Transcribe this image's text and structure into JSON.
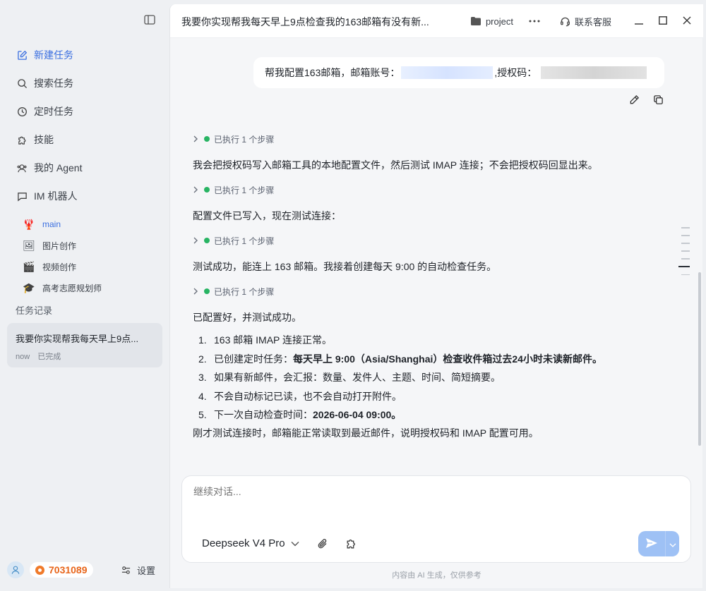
{
  "sidebar": {
    "nav": [
      {
        "label": "新建任务",
        "icon": "edit-icon"
      },
      {
        "label": "搜索任务",
        "icon": "search-icon"
      },
      {
        "label": "定时任务",
        "icon": "clock-icon"
      },
      {
        "label": "技能",
        "icon": "puzzle-icon"
      },
      {
        "label": "我的 Agent",
        "icon": "agent-icon"
      },
      {
        "label": "IM 机器人",
        "icon": "chat-icon"
      }
    ],
    "agents": [
      {
        "label": "main",
        "emoji": "🦞"
      },
      {
        "label": "图片创作",
        "emoji": "🖼"
      },
      {
        "label": "视频创作",
        "emoji": "🎬"
      },
      {
        "label": "高考志愿规划师",
        "emoji": "🎓"
      }
    ],
    "history_title": "任务记录",
    "task": {
      "title": "我要你实现帮我每天早上9点...",
      "time": "now",
      "status": "已完成"
    },
    "points": "7031089",
    "settings_label": "设置"
  },
  "header": {
    "title": "我要你实现帮我每天早上9点检查我的163邮箱有没有新...",
    "project_label": "project",
    "support_label": "联系客服"
  },
  "conversation": {
    "user_message": {
      "prefix": "帮我配置163邮箱，邮箱账号：",
      "middle": ",授权码："
    },
    "step_label": "已执行 1 个步骤",
    "paragraphs": [
      "我会把授权码写入邮箱工具的本地配置文件，然后测试 IMAP 连接；不会把授权码回显出来。",
      "配置文件已写入，现在测试连接：",
      "测试成功，能连上 163 邮箱。我接着创建每天 9:00 的自动检查任务。",
      "已配置好，并测试成功。"
    ],
    "list": [
      {
        "num": "1.",
        "text": "163 邮箱 IMAP 连接正常。",
        "bold": ""
      },
      {
        "num": "2.",
        "text": "已创建定时任务：",
        "bold": "每天早上 9:00（Asia/Shanghai）检查收件箱过去24小时未读新邮件。"
      },
      {
        "num": "3.",
        "text": "如果有新邮件，会汇报：数量、发件人、主题、时间、简短摘要。",
        "bold": ""
      },
      {
        "num": "4.",
        "text": "不会自动标记已读，也不会自动打开附件。",
        "bold": ""
      },
      {
        "num": "5.",
        "text": "下一次自动检查时间：",
        "bold": "2026-06-04 09:00。"
      }
    ],
    "closing": "刚才测试连接时，邮箱能正常读取到最近邮件，说明授权码和 IMAP 配置可用。"
  },
  "composer": {
    "placeholder": "继续对话...",
    "model": "Deepseek V4 Pro"
  },
  "disclaimer": "内容由 AI 生成，仅供参考",
  "colors": {
    "accent": "#3b6fe0",
    "success": "#28b463",
    "points": "#e8651a",
    "send": "#9ec1f5"
  }
}
